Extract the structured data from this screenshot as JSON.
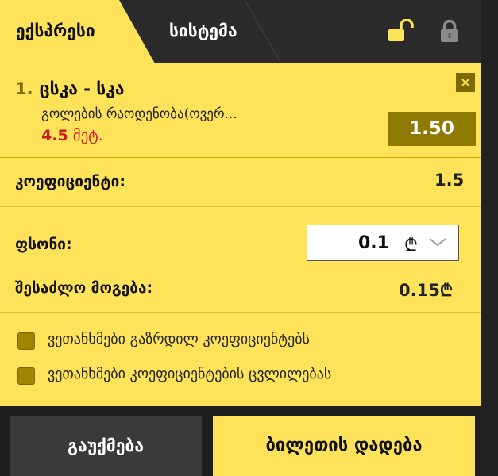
{
  "tabs": {
    "express": "ექსპრესი",
    "system": "სისტემა"
  },
  "icons": {
    "lock_open": "lock-open-icon",
    "lock_closed": "lock-closed-icon",
    "close": "close-icon",
    "currency": "lari-icon",
    "chevron": "chevron-down-icon"
  },
  "bet": {
    "number": "1.",
    "match": "ცსკა - სკა",
    "market": "გოლების რაოდენობა(ოვერ...",
    "line_value": "4.5",
    "line_text": "მეტ.",
    "odds": "1.50",
    "close": "×"
  },
  "coefficient": {
    "label": "კოეფიციენტი:",
    "value": "1.5"
  },
  "stake": {
    "label": "ფსონი:",
    "value": "0.1",
    "currency": "₾"
  },
  "win": {
    "label": "შესაძლო მოგება:",
    "value": "0.15₾"
  },
  "options": [
    {
      "label": "ვეთანხმები გაზრდილ კოეფიციენტებს"
    },
    {
      "label": "ვეთანხმები კოეფიციენტების ცვლილებას"
    }
  ],
  "buttons": {
    "cancel": "გაუქმება",
    "place": "ბილეთის დადება"
  },
  "colors": {
    "accent": "#fde25a",
    "dark": "#2b2b2b",
    "odds_bg": "#8f7900",
    "highlight": "#d01c1c"
  }
}
